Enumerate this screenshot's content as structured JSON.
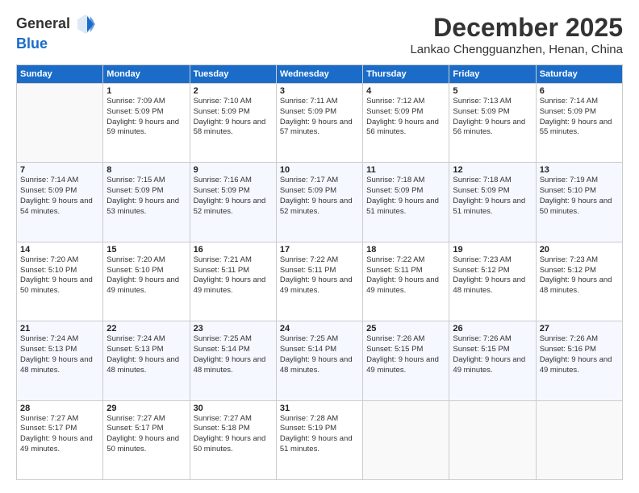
{
  "header": {
    "logo_line1": "General",
    "logo_line2": "Blue",
    "month": "December 2025",
    "location": "Lankao Chengguanzhen, Henan, China"
  },
  "weekdays": [
    "Sunday",
    "Monday",
    "Tuesday",
    "Wednesday",
    "Thursday",
    "Friday",
    "Saturday"
  ],
  "weeks": [
    [
      {
        "day": "",
        "empty": true
      },
      {
        "day": "1",
        "sunrise": "7:09 AM",
        "sunset": "5:09 PM",
        "daylight": "9 hours and 59 minutes."
      },
      {
        "day": "2",
        "sunrise": "7:10 AM",
        "sunset": "5:09 PM",
        "daylight": "9 hours and 58 minutes."
      },
      {
        "day": "3",
        "sunrise": "7:11 AM",
        "sunset": "5:09 PM",
        "daylight": "9 hours and 57 minutes."
      },
      {
        "day": "4",
        "sunrise": "7:12 AM",
        "sunset": "5:09 PM",
        "daylight": "9 hours and 56 minutes."
      },
      {
        "day": "5",
        "sunrise": "7:13 AM",
        "sunset": "5:09 PM",
        "daylight": "9 hours and 56 minutes."
      },
      {
        "day": "6",
        "sunrise": "7:14 AM",
        "sunset": "5:09 PM",
        "daylight": "9 hours and 55 minutes."
      }
    ],
    [
      {
        "day": "7",
        "sunrise": "7:14 AM",
        "sunset": "5:09 PM",
        "daylight": "9 hours and 54 minutes."
      },
      {
        "day": "8",
        "sunrise": "7:15 AM",
        "sunset": "5:09 PM",
        "daylight": "9 hours and 53 minutes."
      },
      {
        "day": "9",
        "sunrise": "7:16 AM",
        "sunset": "5:09 PM",
        "daylight": "9 hours and 52 minutes."
      },
      {
        "day": "10",
        "sunrise": "7:17 AM",
        "sunset": "5:09 PM",
        "daylight": "9 hours and 52 minutes."
      },
      {
        "day": "11",
        "sunrise": "7:18 AM",
        "sunset": "5:09 PM",
        "daylight": "9 hours and 51 minutes."
      },
      {
        "day": "12",
        "sunrise": "7:18 AM",
        "sunset": "5:09 PM",
        "daylight": "9 hours and 51 minutes."
      },
      {
        "day": "13",
        "sunrise": "7:19 AM",
        "sunset": "5:10 PM",
        "daylight": "9 hours and 50 minutes."
      }
    ],
    [
      {
        "day": "14",
        "sunrise": "7:20 AM",
        "sunset": "5:10 PM",
        "daylight": "9 hours and 50 minutes."
      },
      {
        "day": "15",
        "sunrise": "7:20 AM",
        "sunset": "5:10 PM",
        "daylight": "9 hours and 49 minutes."
      },
      {
        "day": "16",
        "sunrise": "7:21 AM",
        "sunset": "5:11 PM",
        "daylight": "9 hours and 49 minutes."
      },
      {
        "day": "17",
        "sunrise": "7:22 AM",
        "sunset": "5:11 PM",
        "daylight": "9 hours and 49 minutes."
      },
      {
        "day": "18",
        "sunrise": "7:22 AM",
        "sunset": "5:11 PM",
        "daylight": "9 hours and 49 minutes."
      },
      {
        "day": "19",
        "sunrise": "7:23 AM",
        "sunset": "5:12 PM",
        "daylight": "9 hours and 48 minutes."
      },
      {
        "day": "20",
        "sunrise": "7:23 AM",
        "sunset": "5:12 PM",
        "daylight": "9 hours and 48 minutes."
      }
    ],
    [
      {
        "day": "21",
        "sunrise": "7:24 AM",
        "sunset": "5:13 PM",
        "daylight": "9 hours and 48 minutes."
      },
      {
        "day": "22",
        "sunrise": "7:24 AM",
        "sunset": "5:13 PM",
        "daylight": "9 hours and 48 minutes."
      },
      {
        "day": "23",
        "sunrise": "7:25 AM",
        "sunset": "5:14 PM",
        "daylight": "9 hours and 48 minutes."
      },
      {
        "day": "24",
        "sunrise": "7:25 AM",
        "sunset": "5:14 PM",
        "daylight": "9 hours and 48 minutes."
      },
      {
        "day": "25",
        "sunrise": "7:26 AM",
        "sunset": "5:15 PM",
        "daylight": "9 hours and 49 minutes."
      },
      {
        "day": "26",
        "sunrise": "7:26 AM",
        "sunset": "5:15 PM",
        "daylight": "9 hours and 49 minutes."
      },
      {
        "day": "27",
        "sunrise": "7:26 AM",
        "sunset": "5:16 PM",
        "daylight": "9 hours and 49 minutes."
      }
    ],
    [
      {
        "day": "28",
        "sunrise": "7:27 AM",
        "sunset": "5:17 PM",
        "daylight": "9 hours and 49 minutes."
      },
      {
        "day": "29",
        "sunrise": "7:27 AM",
        "sunset": "5:17 PM",
        "daylight": "9 hours and 50 minutes."
      },
      {
        "day": "30",
        "sunrise": "7:27 AM",
        "sunset": "5:18 PM",
        "daylight": "9 hours and 50 minutes."
      },
      {
        "day": "31",
        "sunrise": "7:28 AM",
        "sunset": "5:19 PM",
        "daylight": "9 hours and 51 minutes."
      },
      {
        "day": "",
        "empty": true
      },
      {
        "day": "",
        "empty": true
      },
      {
        "day": "",
        "empty": true
      }
    ]
  ]
}
